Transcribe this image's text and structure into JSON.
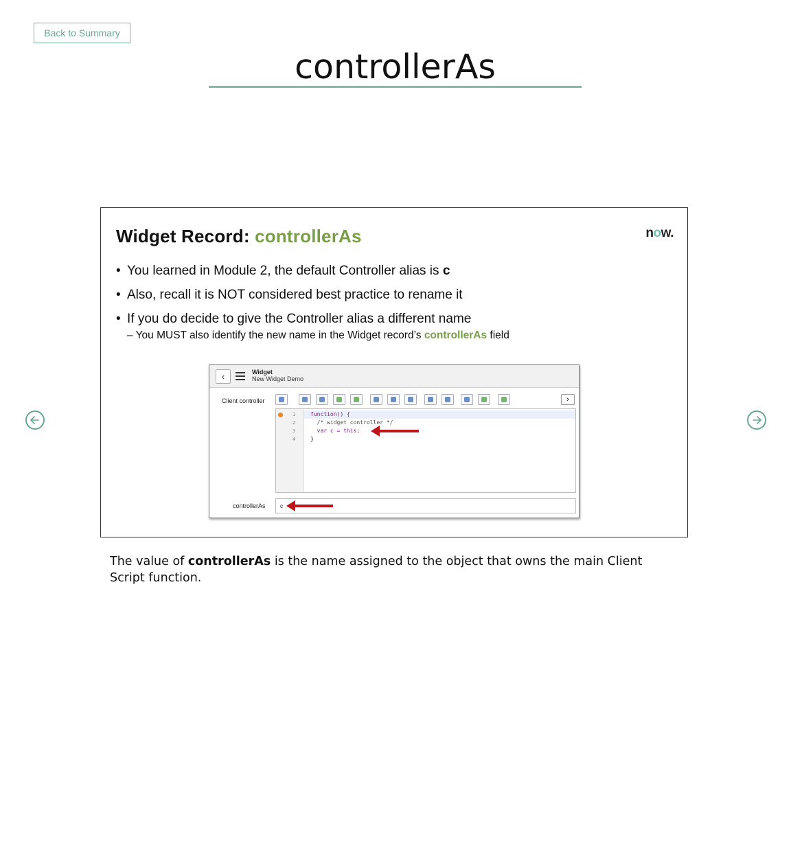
{
  "nav": {
    "back_label": "Back to Summary",
    "prev_icon": "arrow-left-circle-icon",
    "next_icon": "arrow-right-circle-icon"
  },
  "page": {
    "title": "controllerAs"
  },
  "slide": {
    "heading_prefix": "Widget Record: ",
    "heading_accent": "controllerAs",
    "logo": {
      "text_before": "n",
      "text_o": "o",
      "text_after": "w."
    },
    "bullets": [
      {
        "text": "You learned in Module 2, the default Controller alias is ",
        "bold": "c"
      },
      {
        "text": "Also, recall it is NOT considered best practice to rename it"
      },
      {
        "text": "If you do decide to give the Controller alias a different name"
      }
    ],
    "sub_bullet": {
      "prefix": "– You MUST also identify the new name in the Widget record’s ",
      "accent": "controllerAs",
      "suffix": " field"
    },
    "screenshot": {
      "record_type": "Widget",
      "record_name": "New Widget Demo",
      "client_controller_label": "Client controller",
      "controller_as_label": "controllerAs",
      "controller_as_value": "c",
      "code_lines": [
        {
          "num": "1",
          "text_kw": "function() {"
        },
        {
          "num": "2",
          "text_cm": "  /* widget controller */"
        },
        {
          "num": "3",
          "text_kw": "  var c = this;"
        },
        {
          "num": "4",
          "text": "}"
        }
      ],
      "accent_color": "#c0141b"
    }
  },
  "caption": {
    "prefix": "The value of ",
    "bold": "controllerAs",
    "suffix": " is the name assigned to the object that owns the main Client Script function."
  },
  "colors": {
    "accent_green": "#7a9e48",
    "teal": "#6aa693",
    "arrow_red": "#c0141b"
  }
}
